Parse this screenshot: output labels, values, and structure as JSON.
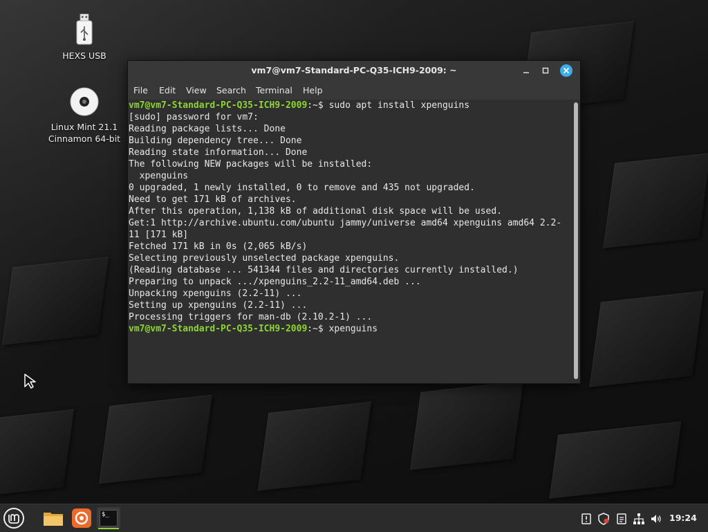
{
  "desktop": {
    "icons": [
      {
        "label_line1": "HEXS USB",
        "label_line2": ""
      },
      {
        "label_line1": "Linux Mint 21.1",
        "label_line2": "Cinnamon 64-bit"
      }
    ]
  },
  "terminal": {
    "title": "vm7@vm7-Standard-PC-Q35-ICH9-2009: ~",
    "menu": [
      "File",
      "Edit",
      "View",
      "Search",
      "Terminal",
      "Help"
    ],
    "prompt": "vm7@vm7-Standard-PC-Q35-ICH9-2009",
    "prompt_suffix": ":~$ ",
    "lines": [
      {
        "type": "prompt",
        "cmd": "sudo apt install xpenguins"
      },
      {
        "type": "out",
        "text": "[sudo] password for vm7:"
      },
      {
        "type": "out",
        "text": "Reading package lists... Done"
      },
      {
        "type": "out",
        "text": "Building dependency tree... Done"
      },
      {
        "type": "out",
        "text": "Reading state information... Done"
      },
      {
        "type": "out",
        "text": "The following NEW packages will be installed:"
      },
      {
        "type": "out",
        "text": "  xpenguins"
      },
      {
        "type": "out",
        "text": "0 upgraded, 1 newly installed, 0 to remove and 435 not upgraded."
      },
      {
        "type": "out",
        "text": "Need to get 171 kB of archives."
      },
      {
        "type": "out",
        "text": "After this operation, 1,138 kB of additional disk space will be used."
      },
      {
        "type": "out",
        "text": "Get:1 http://archive.ubuntu.com/ubuntu jammy/universe amd64 xpenguins amd64 2.2-"
      },
      {
        "type": "out",
        "text": "11 [171 kB]"
      },
      {
        "type": "out",
        "text": "Fetched 171 kB in 0s (2,065 kB/s)"
      },
      {
        "type": "out",
        "text": "Selecting previously unselected package xpenguins."
      },
      {
        "type": "out",
        "text": "(Reading database ... 541344 files and directories currently installed.)"
      },
      {
        "type": "out",
        "text": "Preparing to unpack .../xpenguins_2.2-11_amd64.deb ..."
      },
      {
        "type": "out",
        "text": "Unpacking xpenguins (2.2-11) ..."
      },
      {
        "type": "out",
        "text": "Setting up xpenguins (2.2-11) ..."
      },
      {
        "type": "out",
        "text": "Processing triggers for man-db (2.10.2-1) ..."
      },
      {
        "type": "prompt",
        "cmd": "xpenguins"
      }
    ]
  },
  "taskbar": {
    "items": [
      "mint-menu-icon",
      "files-icon",
      "firefox-icon",
      "terminal-icon"
    ],
    "terminal_glyph": "$_",
    "tray": [
      "notifications-icon",
      "update-manager-icon",
      "clipboard-icon",
      "network-icon",
      "volume-icon"
    ],
    "clock": "19:24"
  },
  "colors": {
    "prompt_green": "#8ed435",
    "terminal_bg": "#2f2f2f",
    "close_button": "#3daee9"
  }
}
